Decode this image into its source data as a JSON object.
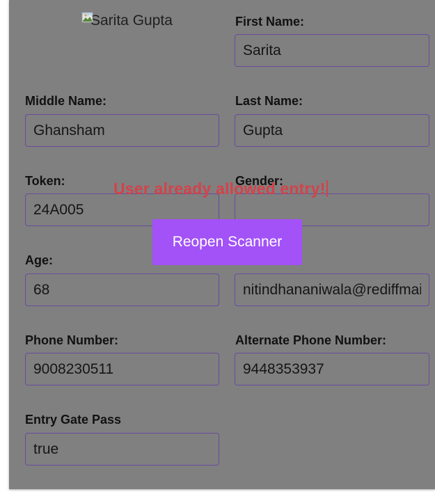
{
  "profile": {
    "image_alt": "Sarita Gupta",
    "image_icon": "broken-image-icon"
  },
  "fields": {
    "first_name": {
      "label": "First Name:",
      "value": "Sarita"
    },
    "middle_name": {
      "label": "Middle Name:",
      "value": "Ghansham"
    },
    "last_name": {
      "label": "Last Name:",
      "value": "Gupta"
    },
    "token": {
      "label": "Token:",
      "value": "24A005"
    },
    "gender": {
      "label": "Gender:",
      "value": ""
    },
    "age": {
      "label": "Age:",
      "value": "68"
    },
    "email": {
      "label": "",
      "value": "nitindhananiwala@rediffmail.com"
    },
    "phone": {
      "label": "Phone Number:",
      "value": "9008230511"
    },
    "alt_phone": {
      "label": "Alternate Phone Number:",
      "value": "9448353937"
    },
    "entry_gate_pass": {
      "label": "Entry Gate Pass",
      "value": "true"
    }
  },
  "alert": {
    "message": "User already allowed entry!",
    "color": "#d2434a"
  },
  "actions": {
    "reopen_scanner_label": "Reopen Scanner",
    "button_color": "#a252f7"
  },
  "colors": {
    "overlay_background": "#808080",
    "input_border": "#6a4a9c"
  }
}
